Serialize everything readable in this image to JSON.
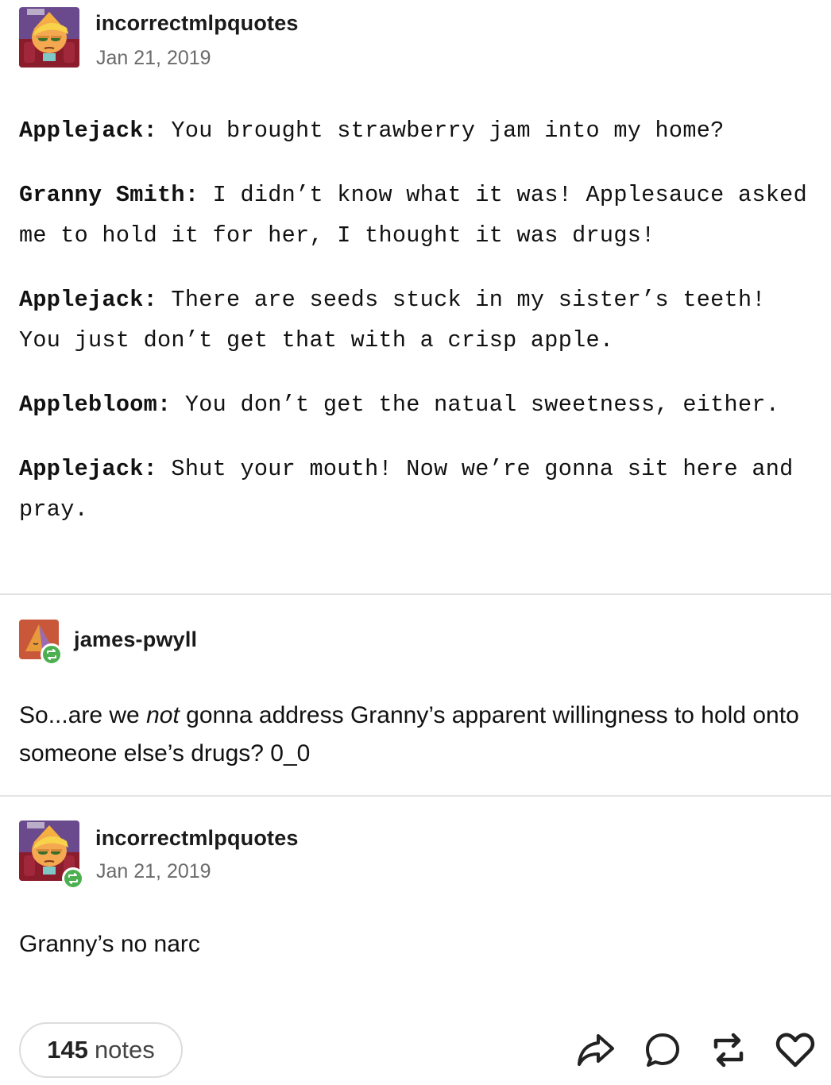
{
  "post": {
    "author": "incorrectmlpquotes",
    "date": "Jan 21, 2019",
    "lines": [
      {
        "speaker": "Applejack:",
        "text": " You brought strawberry jam into my home?"
      },
      {
        "speaker": "Granny Smith:",
        "text": " I didn’t know what it was! Applesauce asked me to hold it for her, I thought it was drugs!"
      },
      {
        "speaker": "Applejack:",
        "text": " There are seeds stuck in my sister’s teeth! You just don’t get that with a crisp apple."
      },
      {
        "speaker": "Applebloom:",
        "text": " You don’t get the natual sweetness, either."
      },
      {
        "speaker": "Applejack:",
        "text": " Shut your mouth! Now we’re gonna sit here and pray."
      }
    ]
  },
  "reblog1": {
    "author": "james-pwyll",
    "text_before": "So...are we ",
    "text_italic": "not",
    "text_after": " gonna address Granny’s apparent willingness to hold onto someone else’s drugs? 0_0"
  },
  "reblog2": {
    "author": "incorrectmlpquotes",
    "date": "Jan 21, 2019",
    "text": "Granny’s no narc"
  },
  "footer": {
    "notes_count": "145",
    "notes_label": "notes",
    "actions": [
      "share-icon",
      "reply-icon",
      "reblog-icon",
      "like-icon"
    ]
  },
  "colors": {
    "badge": "#4caf50",
    "divider": "#e4e4e4",
    "muted": "#6b6b6b"
  }
}
